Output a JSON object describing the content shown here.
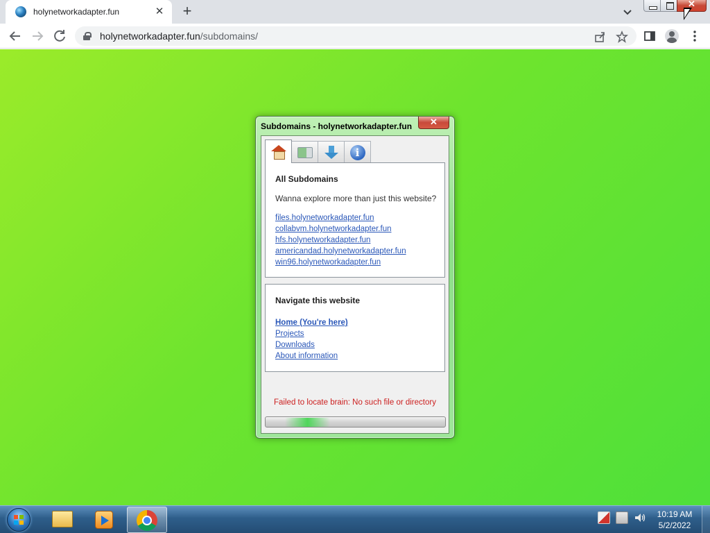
{
  "browser": {
    "tab_title": "holynetworkadapter.fun",
    "tab_close": "✕",
    "new_tab": "+",
    "url_host": "holynetworkadapter.fun",
    "url_path": "/subdomains/",
    "window_close": "✕"
  },
  "dialog": {
    "title": "Subdomains - holynetworkadapter.fun",
    "close": "✕",
    "tabs": [
      {
        "icon": "house-icon"
      },
      {
        "icon": "video-icon"
      },
      {
        "icon": "download-icon"
      },
      {
        "icon": "info-icon",
        "glyph": "i"
      }
    ],
    "all_subdomains": {
      "heading": "All Subdomains",
      "text": "Wanna explore more than just this website?",
      "links": [
        "files.holynetworkadapter.fun",
        "collabvm.holynetworkadapter.fun",
        "hfs.holynetworkadapter.fun",
        "americandad.holynetworkadapter.fun",
        "win96.holynetworkadapter.fun"
      ]
    },
    "navigate": {
      "heading": "Navigate this website",
      "links": [
        "Home (You're here)",
        "Projects",
        "Downloads",
        "About information"
      ]
    },
    "error": "Failed to locate brain: No such file or directory",
    "progress_fraction": 0.25
  },
  "taskbar": {
    "clock_time": "10:19 AM",
    "clock_date": "5/2/2022"
  },
  "colors": {
    "page_bg_start": "#9beb2a",
    "page_bg_end": "#4fe03a",
    "link": "#2a57b8",
    "error": "#cc2020"
  }
}
